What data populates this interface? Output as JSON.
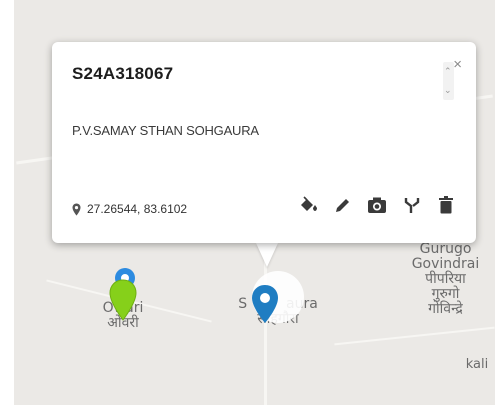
{
  "popup": {
    "title": "S24A318067",
    "subtitle": "P.V.SAMAY STHAN SOHGAURA",
    "coordinates": "27.26544, 83.6102",
    "close_symbol": "×",
    "icons": [
      "map-pin-icon",
      "paint-bucket-icon",
      "pencil-icon",
      "camera-icon",
      "split-icon",
      "trash-icon",
      "close-icon"
    ]
  },
  "map": {
    "labels": {
      "owari_en": "Owari",
      "owari_hi": "ओवरी",
      "sohgaura_left": "S",
      "sohgaura_right": "aura",
      "sohgaura_hi": "सोहगौरा",
      "gurugo": "Gurugo",
      "govindrai": "Govindrai",
      "pipariya_hi": "पीपरिया",
      "gurugo_hi": "गुरुगो",
      "govindrai_hi": "गोविन्द्रे",
      "kali": "kali"
    },
    "colors": {
      "selected_pin": "#1f7dc2",
      "green_pin": "#86d01a",
      "blue_pin": "#2d8be0"
    }
  }
}
